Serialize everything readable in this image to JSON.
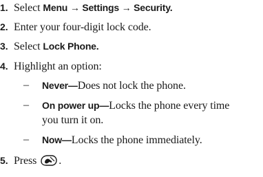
{
  "steps": [
    {
      "number": "1.",
      "prefix": "Select ",
      "path": "Menu → Settings → Security."
    },
    {
      "number": "2.",
      "text": "Enter your four-digit lock code."
    },
    {
      "number": "3.",
      "prefix": "Select ",
      "bold": "Lock Phone."
    },
    {
      "number": "4.",
      "text": "Highlight an option:",
      "options": [
        {
          "dash": "–",
          "label": "Never—",
          "desc": "Does not lock the phone."
        },
        {
          "dash": "–",
          "label": "On power up—",
          "desc": "Locks the phone every time",
          "desc_cont": "you turn it on."
        },
        {
          "dash": "–",
          "label": "Now—",
          "desc": "Locks the phone immediately."
        }
      ]
    },
    {
      "number": "5.",
      "prefix": "Press",
      "suffix": ".",
      "icon": "end-power-key-icon"
    }
  ]
}
